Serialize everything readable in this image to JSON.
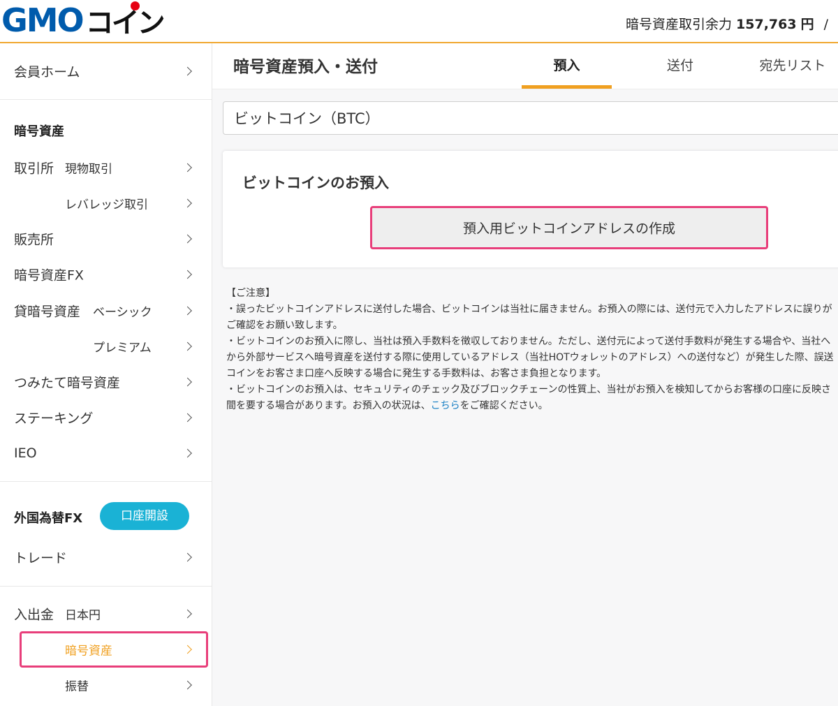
{
  "header": {
    "logo_primary": "GMO",
    "logo_secondary": "コイン",
    "balance_label": "暗号資産取引余力",
    "balance_amount": "157,763",
    "balance_unit": "円",
    "separator": "/"
  },
  "sidebar": {
    "member_home": "会員ホーム",
    "crypto_section": "暗号資産",
    "exchange_label": "取引所",
    "exchange_spot": "現物取引",
    "exchange_leverage": "レバレッジ取引",
    "sales_office": "販売所",
    "crypto_fx": "暗号資産FX",
    "lending_label": "貸暗号資産",
    "lending_basic": "ベーシック",
    "lending_premium": "プレミアム",
    "tsumitate": "つみたて暗号資産",
    "staking": "ステーキング",
    "ieo": "IEO",
    "fx_section": "外国為替FX",
    "open_account": "口座開設",
    "trade": "トレード",
    "deposit_label": "入出金",
    "deposit_jpy": "日本円",
    "deposit_crypto": "暗号資産",
    "transfer": "振替"
  },
  "main": {
    "title": "暗号資産預入・送付",
    "tabs": [
      {
        "label": "預入",
        "active": true
      },
      {
        "label": "送付",
        "active": false
      },
      {
        "label": "宛先リスト",
        "active": false
      }
    ],
    "coin_select": "ビットコイン（BTC）",
    "card_title": "ビットコインのお預入",
    "create_button": "預入用ビットコインアドレスの作成",
    "notice": {
      "heading": "【ご注意】",
      "line1": "・誤ったビットコインアドレスに送付した場合、ビットコインは当社に届きません。お預入の際には、送付元で入力したアドレスに誤りが",
      "line2": "ご確認をお願い致します。",
      "line3": "・ビットコインのお預入に際し、当社は預入手数料を徴収しておりません。ただし、送付元によって送付手数料が発生する場合や、当社へ",
      "line4": "から外部サービスへ暗号資産を送付する際に使用しているアドレス（当社HOTウォレットのアドレス）への送付など）が発生した際、誤送",
      "line5": "コインをお客さま口座へ反映する場合に発生する手数料は、お客さま負担となります。",
      "line6": "・ビットコインのお預入は、セキュリティのチェック及びブロックチェーンの性質上、当社がお預入を検知してからお客様の口座に反映さ",
      "line7_prefix": "間を要する場合があります。お預入の状況は、",
      "line7_link": "こちら",
      "line7_suffix": "をご確認ください。"
    }
  },
  "colors": {
    "accent_orange": "#f0a020",
    "brand_blue": "#005bac",
    "highlight_pink": "#e83e7a",
    "button_cyan": "#1ab2d5",
    "link_blue": "#1a80c4"
  }
}
